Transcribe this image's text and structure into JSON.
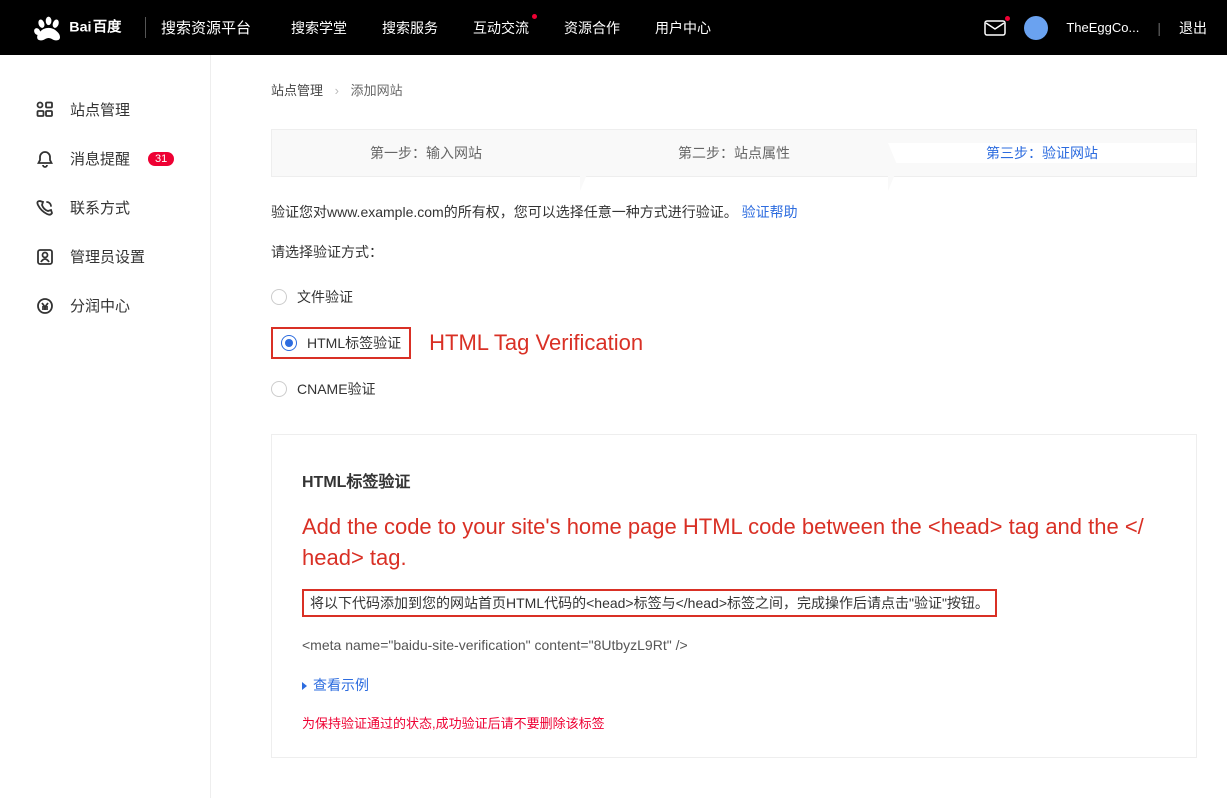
{
  "header": {
    "logo_text": "百度",
    "platform": "搜索资源平台",
    "nav": [
      "搜索学堂",
      "搜索服务",
      "互动交流",
      "资源合作",
      "用户中心"
    ],
    "username": "TheEggCo...",
    "logout": "退出"
  },
  "sidebar": {
    "items": [
      {
        "label": "站点管理"
      },
      {
        "label": "消息提醒",
        "badge": "31"
      },
      {
        "label": "联系方式"
      },
      {
        "label": "管理员设置"
      },
      {
        "label": "分润中心"
      }
    ]
  },
  "breadcrumb": {
    "parent": "站点管理",
    "current": "添加网站"
  },
  "steps": [
    "第一步：输入网站",
    "第二步：站点属性",
    "第三步：验证网站"
  ],
  "instruction": {
    "prefix": "验证您对www.example.com的所有权，您可以选择任意一种方式进行验证。",
    "help_link": "验证帮助"
  },
  "choose_label": "请选择验证方式：",
  "radios": {
    "file": "文件验证",
    "html": "HTML标签验证",
    "cname": "CNAME验证"
  },
  "annotation_html": "HTML Tag Verification",
  "panel": {
    "title": "HTML标签验证",
    "annotation": "Add the code to your site's home page HTML code between the <head> tag and the </ head> tag.",
    "instruction": "将以下代码添加到您的网站首页HTML代码的<head>标签与</head>标签之间，完成操作后请点击\"验证\"按钮。",
    "code": "<meta name=\"baidu-site-verification\" content=\"8UtbyzL9Rt\" />",
    "example_link": "查看示例",
    "warning": "为保持验证通过的状态,成功验证后请不要删除该标签"
  }
}
